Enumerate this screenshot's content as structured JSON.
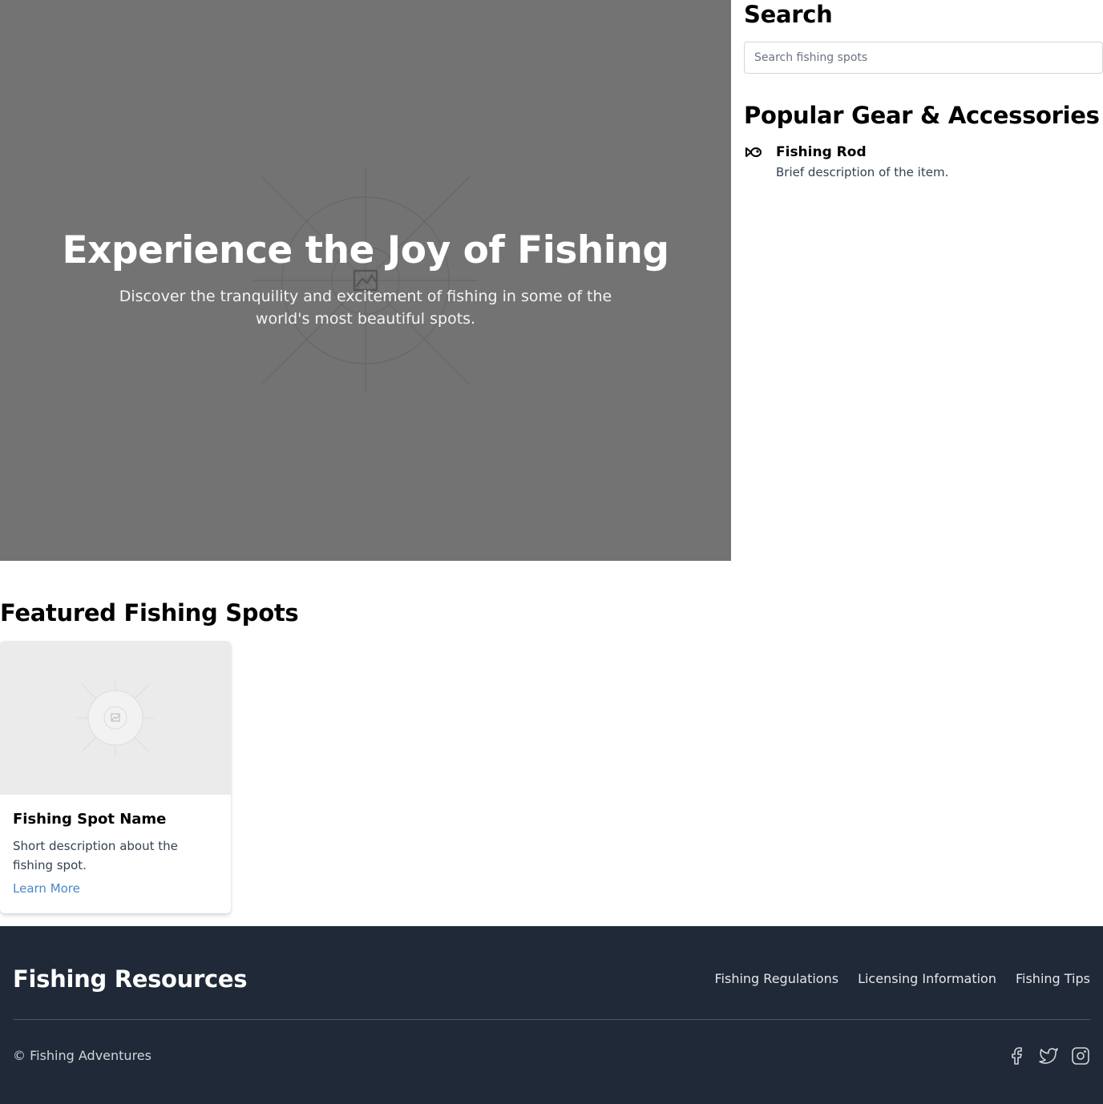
{
  "hero": {
    "title": "Experience the Joy of Fishing",
    "subtitle": "Discover the tranquility and excitement of fishing in some of the world's most beautiful spots.",
    "background_color": "#737373"
  },
  "sidebar": {
    "search_heading": "Search",
    "search_placeholder": "Search fishing spots",
    "search_value": "",
    "gear_heading": "Popular Gear & Accessories",
    "gear_items": [
      {
        "icon": "fish-icon",
        "name": "Fishing Rod",
        "description": "Brief description of the item."
      }
    ]
  },
  "featured": {
    "heading": "Featured Fishing Spots",
    "cards": [
      {
        "title": "Fishing Spot Name",
        "description": "Short description about the fishing spot.",
        "link_label": "Learn More"
      }
    ]
  },
  "footer": {
    "title": "Fishing Resources",
    "links": [
      "Fishing Regulations",
      "Licensing Information",
      "Fishing Tips"
    ],
    "copyright": "© Fishing Adventures",
    "social_icons": [
      "facebook-icon",
      "twitter-icon",
      "instagram-icon"
    ],
    "background_color": "#1f2937"
  },
  "colors": {
    "link": "#4a86c8",
    "card_image_bg": "#ebebeb"
  }
}
